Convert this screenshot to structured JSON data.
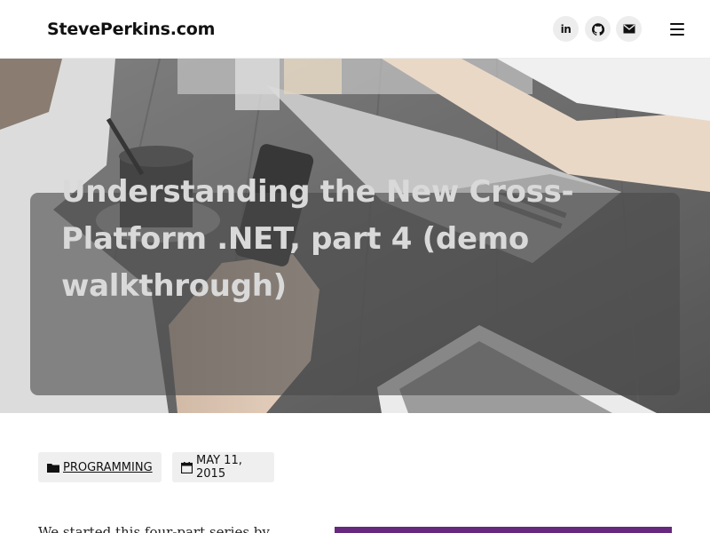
{
  "header": {
    "site_title": "StevePerkins.com",
    "social": [
      {
        "name": "LinkedIn",
        "icon": "linkedin-icon",
        "glyph": "in"
      },
      {
        "name": "GitHub",
        "icon": "github-icon"
      },
      {
        "name": "Email",
        "icon": "email-icon"
      }
    ],
    "menu_icon": "hamburger-menu-icon"
  },
  "hero": {
    "title": "Understanding the New Cross-Platform .NET, part 4 (demo walkthrough)"
  },
  "meta": {
    "category_icon": "folder-icon",
    "category": "PROGRAMMING",
    "date_icon": "calendar-icon",
    "date": "MAY 11, 2015"
  },
  "content": {
    "excerpt_start": "We started this four-part series by"
  },
  "colors": {
    "accent_purple": "#66297e",
    "title_text": "#d9d9d9",
    "chip_background": "#efefef"
  }
}
